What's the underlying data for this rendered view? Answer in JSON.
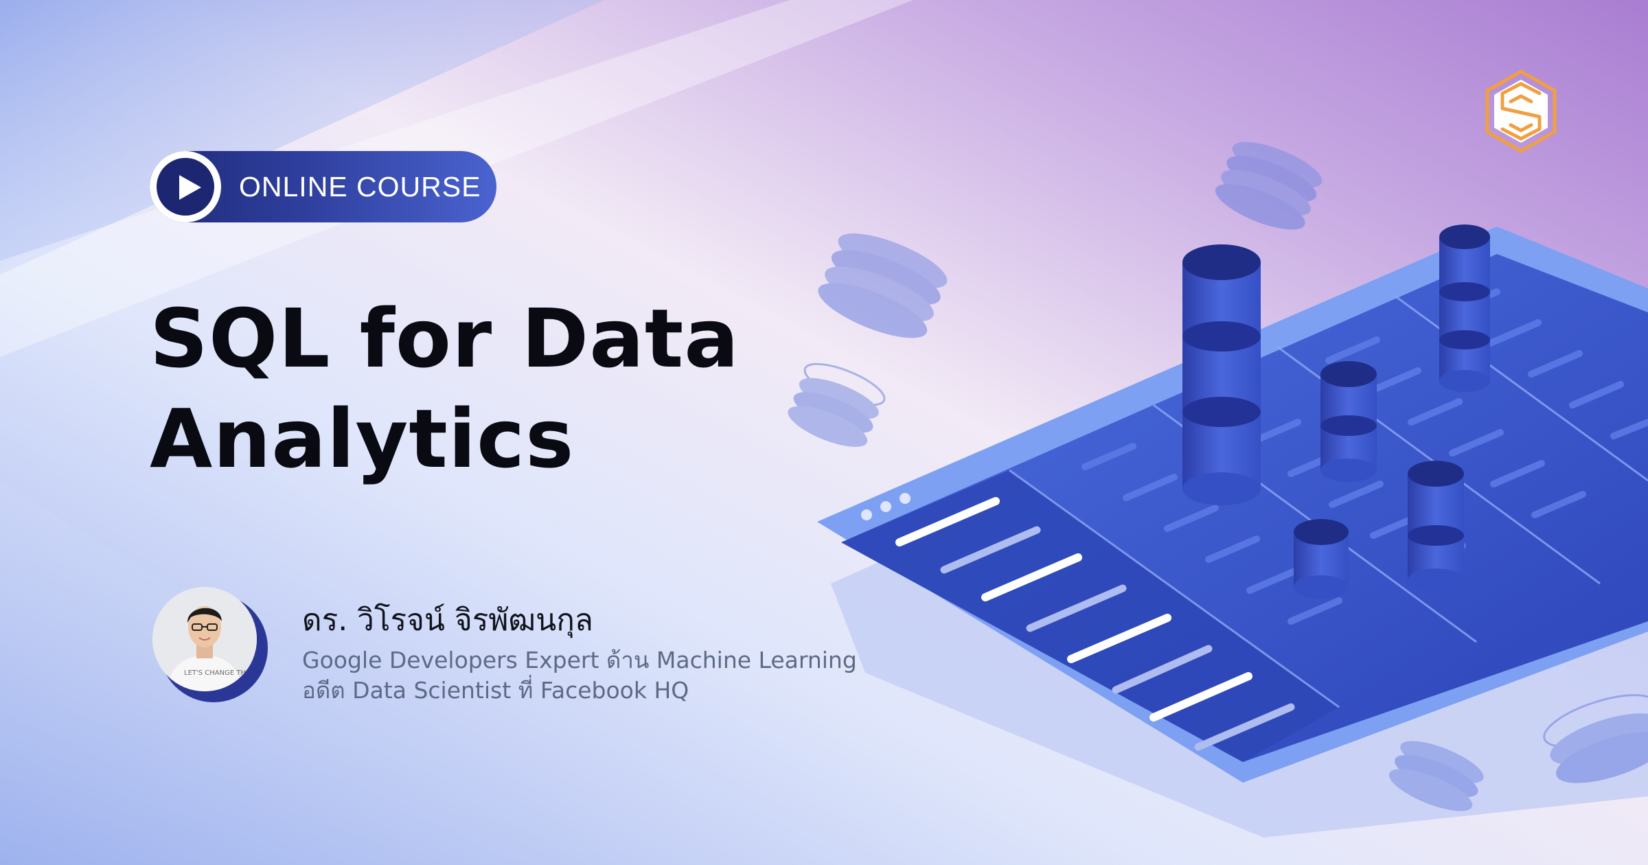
{
  "colors": {
    "accent_dark": "#1d2670",
    "accent_blue": "#3b55d0",
    "title_text": "#0a0a12",
    "subtitle_text": "#5d6a86",
    "logo_orange": "#f0a040"
  },
  "badge": {
    "label": "ONLINE COURSE",
    "icon": "play-icon"
  },
  "course": {
    "title_line1": "SQL for Data",
    "title_line2": "Analytics"
  },
  "instructor": {
    "name": "ดร. วิโรจน์ จิรพัฒนกุล",
    "line1": "Google Developers Expert ด้าน Machine Learning",
    "line2": "อดีต Data Scientist ที่ Facebook HQ",
    "shirt_text": "LET'S CHANGE THE WAY"
  },
  "logo": {
    "icon": "brand-hexagon-logo"
  }
}
